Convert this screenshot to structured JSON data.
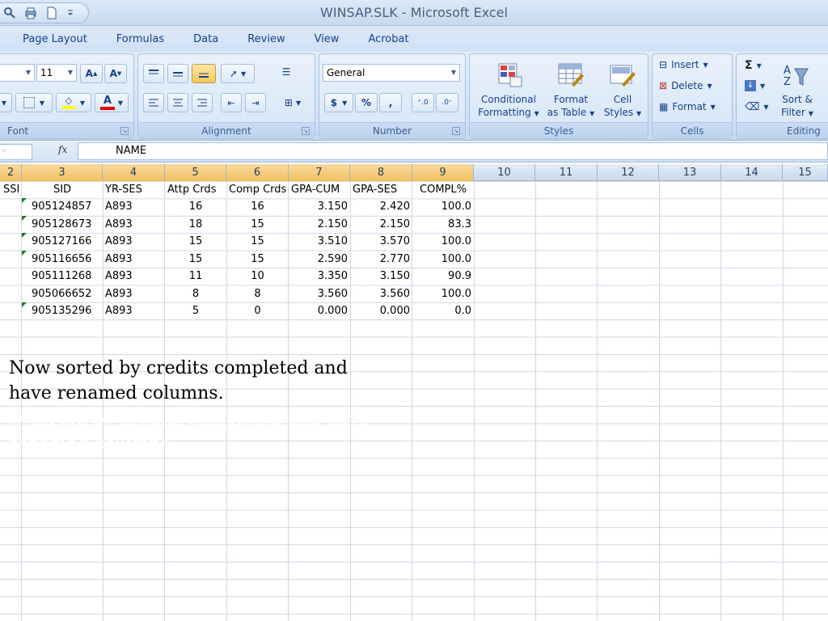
{
  "window": {
    "title": "WINSAP.SLK - Microsoft Excel"
  },
  "ribbon_tabs": [
    "Page Layout",
    "Formulas",
    "Data",
    "Review",
    "View",
    "Acrobat"
  ],
  "ribbon": {
    "font": {
      "label": "Font",
      "size": "11"
    },
    "alignment": {
      "label": "Alignment"
    },
    "number": {
      "label": "Number",
      "format": "General",
      "currency": "$",
      "percent": "%",
      "comma": ","
    },
    "styles": {
      "label": "Styles",
      "conditional": [
        "Conditional",
        "Formatting"
      ],
      "format_table": [
        "Format",
        "as Table"
      ],
      "cell_styles": [
        "Cell",
        "Styles"
      ]
    },
    "cells": {
      "label": "Cells",
      "insert": "Insert",
      "delete": "Delete",
      "format": "Format"
    },
    "editing": {
      "label": "Editing",
      "sort": [
        "Sort &",
        "Filter"
      ]
    }
  },
  "formula_bar": {
    "fx": "fx",
    "value": "NAME"
  },
  "columns": [
    "2",
    "3",
    "4",
    "5",
    "6",
    "7",
    "8",
    "9",
    "10",
    "11",
    "12",
    "13",
    "14",
    "15"
  ],
  "table": {
    "headers": [
      "SSI",
      "SID",
      "YR-SES",
      "Attp Crds",
      "Comp Crds",
      "GPA-CUM",
      "GPA-SES",
      "COMPL%"
    ],
    "rows": [
      [
        "905124857",
        "A893",
        "16",
        "16",
        "3.150",
        "2.420",
        "100.0"
      ],
      [
        "905128673",
        "A893",
        "18",
        "15",
        "2.150",
        "2.150",
        "83.3"
      ],
      [
        "905127166",
        "A893",
        "15",
        "15",
        "3.510",
        "3.570",
        "100.0"
      ],
      [
        "905116656",
        "A893",
        "15",
        "15",
        "2.590",
        "2.770",
        "100.0"
      ],
      [
        "905111268",
        "A893",
        "11",
        "10",
        "3.350",
        "3.150",
        "90.9"
      ],
      [
        "905066652",
        "A893",
        "8",
        "8",
        "3.560",
        "3.560",
        "100.0"
      ],
      [
        "905135296",
        "A893",
        "5",
        "0",
        "0.000",
        "0.000",
        "0.0"
      ]
    ]
  },
  "caption": {
    "line1": "Now sorted by credits completed and",
    "line2": "have renamed columns.",
    "ghost1": "w sorted by credits completed and have",
    "ghost2": "renamed columns."
  },
  "colors": {
    "ribbon": "#d2e2f5",
    "grid_line": "#d0d7e5",
    "selected_col": "#f1c15f",
    "error_triangle": "#1e7a1e"
  }
}
